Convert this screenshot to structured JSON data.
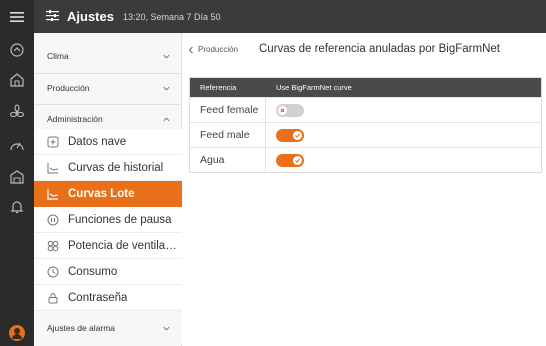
{
  "header": {
    "title": "Ajustes",
    "subtitle": "13:20, Semana 7 Día 50"
  },
  "sidebar": {
    "sections": [
      {
        "label": "Clima"
      },
      {
        "label": "Producción"
      },
      {
        "label": "Administración"
      }
    ],
    "items": [
      {
        "label": "Datos nave",
        "icon": "plus-square-icon"
      },
      {
        "label": "Curvas de historial",
        "icon": "curve-icon"
      },
      {
        "label": "Curvas Lote",
        "icon": "curve-icon"
      },
      {
        "label": "Funciones de pausa",
        "icon": "pause-icon"
      },
      {
        "label": "Potencia de ventilación",
        "icon": "fan-icon"
      },
      {
        "label": "Consumo",
        "icon": "clock-icon"
      },
      {
        "label": "Contraseña",
        "icon": "lock-icon"
      }
    ],
    "alarm_section": {
      "label": "Ajustes de alarma"
    }
  },
  "content": {
    "breadcrumb": "Producción",
    "title": "Curvas de referencia anuladas por BigFarmNet",
    "table": {
      "headers": [
        "Referencia",
        "Use BigFarmNet curve"
      ],
      "rows": [
        {
          "label": "Feed female",
          "enabled": false
        },
        {
          "label": "Feed male",
          "enabled": true
        },
        {
          "label": "Agua",
          "enabled": true
        }
      ]
    }
  },
  "colors": {
    "accent": "#e8701a",
    "rail": "#2b2b2b",
    "topbar": "#3b3b3b",
    "table_header": "#4a4a4a"
  }
}
